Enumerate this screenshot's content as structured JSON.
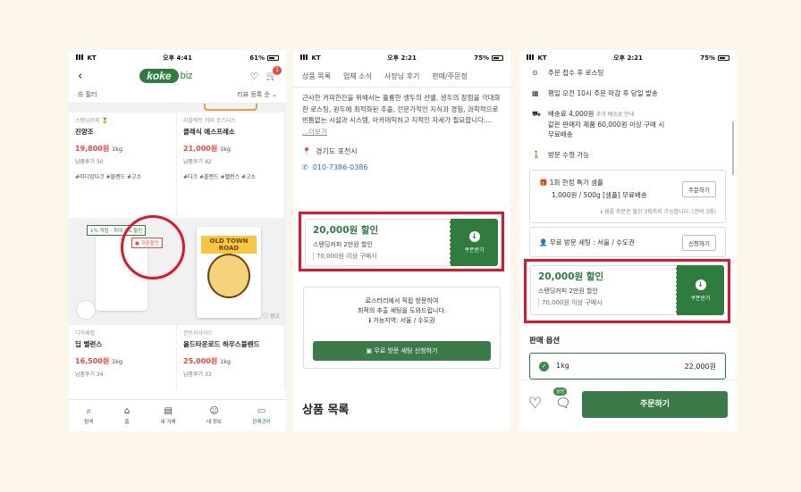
{
  "phone1": {
    "status": {
      "carrier": "KT",
      "time": "오후 4:41",
      "battery": "61%"
    },
    "logo": {
      "mark": "koke",
      "suffix": "biz"
    },
    "cart_count": "1",
    "filter_label": "필터",
    "sort_label": "리뷰 등록 순",
    "products": [
      {
        "category": "스탠딩커피",
        "name": "진양조",
        "price": "19,800원",
        "unit": "1kg",
        "reviews": "납품후기 50",
        "tags": "#미디엄다크 #블렌드 #고소"
      },
      {
        "category": "리플렉트 커피 로스터스",
        "name": "클래식 에스프레소",
        "price": "21,000원",
        "unit": "1kg",
        "reviews": "납품후기 42",
        "tags": "#다크 #블렌드 #밸런스 #고소"
      },
      {
        "category": "디카페랩",
        "name": "딥 벨런스",
        "price": "16,500원",
        "unit": "1kg",
        "reviews": "납품후기 34",
        "badge_green": "1% 적립 · 최대 3% 할인",
        "badge_red": "쿠폰할인"
      },
      {
        "category": "컨트리사이드",
        "name": "올드타운로드 하우스블렌드",
        "price": "25,000원",
        "unit": "1kg",
        "reviews": "납품후기 33",
        "bag_label": "OLD TOWN ROAD",
        "ad_label": "광고"
      }
    ],
    "tabs": [
      {
        "label": "탐색",
        "icon": "search-icon"
      },
      {
        "label": "홈",
        "icon": "home-icon"
      },
      {
        "label": "내 거래",
        "icon": "calendar-icon"
      },
      {
        "label": "내 정보",
        "icon": "smile-icon"
      },
      {
        "label": "판매관리",
        "icon": "manage-icon"
      }
    ]
  },
  "phone2": {
    "status": {
      "carrier": "KT",
      "time": "오후 2:21",
      "battery": "75%"
    },
    "tabs": [
      "상품 목록",
      "업체 소식",
      "사장님 후기",
      "판매/주문정"
    ],
    "description": "근사한 커피한잔을 위해서는 훌륭한 생두의 선별, 생두의 장점을 극대화한 로스팅, 원두에 최적화된 추출, 전문가적인 지식과 경험, 과학적으로 빈틈없는 시설과 시스템, 아카데믹하고 지적인 자세가 필요합니다....",
    "more_label": "...더보기",
    "location": "경기도 포천시",
    "phone": "010-7386-0386",
    "coupon": {
      "amount": "20,000원 할인",
      "desc": "스탠딩커피 2만원 할인",
      "cond": "70,000원 이상 구매시",
      "button": "쿠폰받기"
    },
    "visit": {
      "line1": "로스터리에서 직접 방문하여",
      "line2": "최적의 추출 세팅을 도와드립니다.",
      "area": "가능지역: 서울 / 수도권",
      "button": "무료 방문 세팅 신청하기"
    },
    "section_title": "상품 목록"
  },
  "phone3": {
    "status": {
      "carrier": "KT",
      "time": "오후 2:21",
      "battery": "75%"
    },
    "info_rows": [
      {
        "icon": "roast-icon",
        "text": "주문 접수 후 로스팅"
      },
      {
        "icon": "calendar-icon",
        "text": "평일 오전 10시 주문 마감 후 당일 발송"
      },
      {
        "icon": "truck-icon",
        "text": "배송료 4,000원",
        "note": "추가 배송료 안내",
        "extra": "같은 판매자 제품 60,000원 이상 구매 시",
        "extra2": "무료배송"
      },
      {
        "icon": "walk-icon",
        "text": "방문 수령 가능"
      }
    ],
    "sample": {
      "title": "1회 한정 특가 샘플",
      "detail": "1,000원 / 500g [샘플] 무료배송",
      "note": "샘플 주문은 월간 3회까지 가능합니다. (잔여 3회)",
      "button": "주문하기"
    },
    "visit_setting": {
      "title": "무료 방문 세팅 : 서울 / 수도권",
      "button": "신청하기"
    },
    "coupon": {
      "amount": "20,000원 할인",
      "desc": "스탠딩커피 2만원 할인",
      "cond": "70,000원 이상 구매시",
      "button": "쿠폰받기"
    },
    "options_title": "판매 옵션",
    "option": {
      "name": "1kg",
      "price": "22,000원"
    },
    "chat_label": "상담",
    "buy_button": "주문하기"
  },
  "colors": {
    "brand_green": "#2e7d3f",
    "highlight_red": "#e0152a",
    "price_red": "#e84a3b",
    "background": "#fcf5e9"
  }
}
